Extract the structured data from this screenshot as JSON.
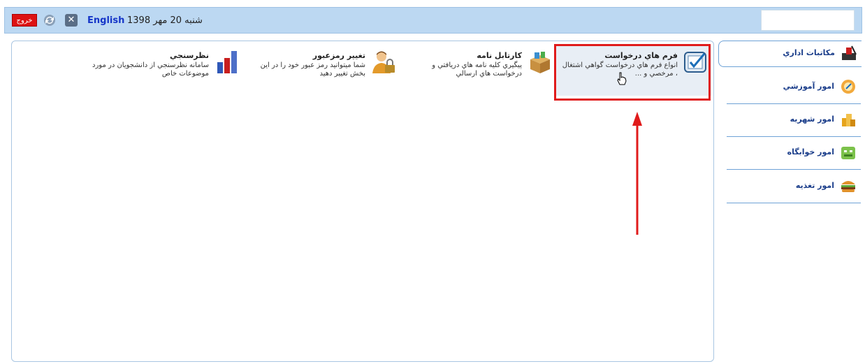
{
  "topbar": {
    "exit_label": "خروج",
    "lang_label": "English",
    "date_text": "شنبه 20 مهر 1398"
  },
  "tiles": [
    {
      "title": "فرم هاي درخواست",
      "desc": "انواع فرم هاي درخواست گواهي اشتغال ، مرخصي و ..."
    },
    {
      "title": "كارتابل نامه",
      "desc": "پيگيري كليه نامه هاي دريافتي و درخواست هاي ارسالي"
    },
    {
      "title": "تغيير رمزعبور",
      "desc": "شما ميتوانيد رمز عبور خود را در اين بخش تغيير دهيد"
    },
    {
      "title": "نظرسنجي",
      "desc": "سامانه نظرسنجي از دانشجويان در مورد موضوعات خاص"
    }
  ],
  "sidebar": {
    "items": [
      {
        "label": "مكاتبات اداري"
      },
      {
        "label": "امور آموزشي"
      },
      {
        "label": "امور شهريه"
      },
      {
        "label": "امور خوابگاه"
      },
      {
        "label": "امور تغذيه"
      }
    ]
  },
  "colors": {
    "topbar_bg": "#bcd8f2",
    "exit_red": "#dd1212",
    "highlight_red": "#e01b1b",
    "link_blue": "#1636c8",
    "sidebar_border": "#6ea2d6"
  }
}
